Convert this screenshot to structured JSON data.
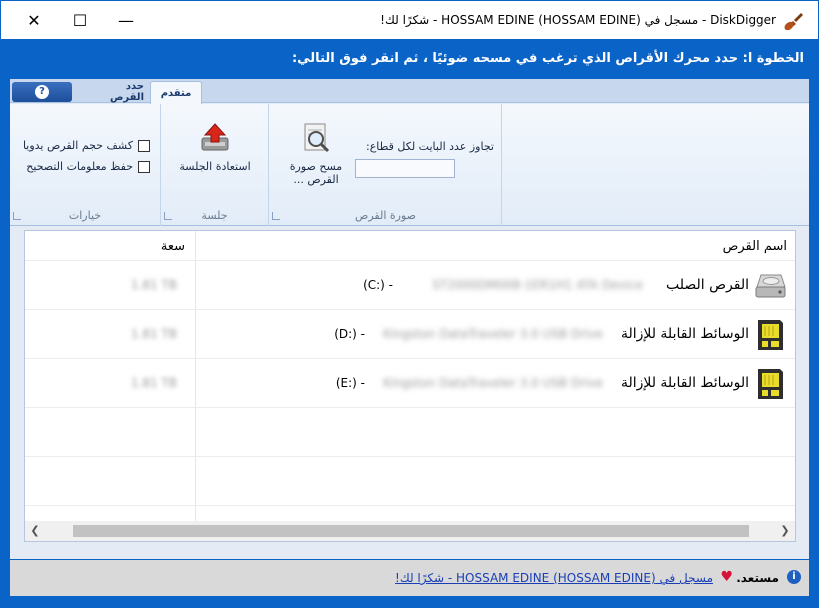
{
  "titlebar": {
    "title": "DiskDigger - مسجل في HOSSAM EDINE (HOSSAM EDINE) - شكرًا لك!",
    "app_icon": "shovel-icon",
    "close_symbol": "✕",
    "maximize_symbol": "☐",
    "minimize_symbol": "—"
  },
  "step": {
    "text": "الخطوة ا: حدد محرك الأقراص الذي ترغب في مسحه ضوئيًا ، ثم انقر فوق التالي:"
  },
  "ribbon": {
    "tabs": {
      "advanced": "متقدم",
      "select_disk": "حدد القرص",
      "help": "?"
    },
    "disk_image_group": {
      "label": "صورة القرص",
      "bytes_label": "تجاوز عدد البايت لكل قطاع:",
      "bytes_value": "",
      "scan_image_label": "مسح صورة القرص ..."
    },
    "session_group": {
      "label": "جلسة",
      "restore_label": "استعادة الجلسة"
    },
    "options_group": {
      "label": "خيارات",
      "detect_size_label": "كشف حجم القرص يدويا",
      "save_fix_label": "حفظ معلومات التصحيح"
    }
  },
  "list": {
    "columns": {
      "name": "اسم القرص",
      "size": "سعة"
    },
    "rows": [
      {
        "type": "القرص الصلب",
        "model": "ST2000DM008-1ER1H1 ATA Device",
        "letter": "(C:) -",
        "size": "1.81 TB",
        "icon": "hard-drive-icon"
      },
      {
        "type": "الوسائط القابلة للإزالة",
        "model": "Kingston DataTraveler 3.0 USB Drive",
        "letter": "(D:) -",
        "size": "1.81 TB",
        "icon": "memory-card-icon"
      },
      {
        "type": "الوسائط القابلة للإزالة",
        "model": "Kingston DataTraveler 3.0 USB Drive",
        "letter": "(E:) -",
        "size": "1.81 TB",
        "icon": "memory-card-icon"
      }
    ]
  },
  "status": {
    "ready": "مستعد.",
    "registered_link": "مسجل في HOSSAM EDINE (HOSSAM EDINE) - شكرًا لك!"
  },
  "colors": {
    "accent": "#0a64c8",
    "status_bg": "#d9d9d9",
    "heart": "#d6123b"
  }
}
